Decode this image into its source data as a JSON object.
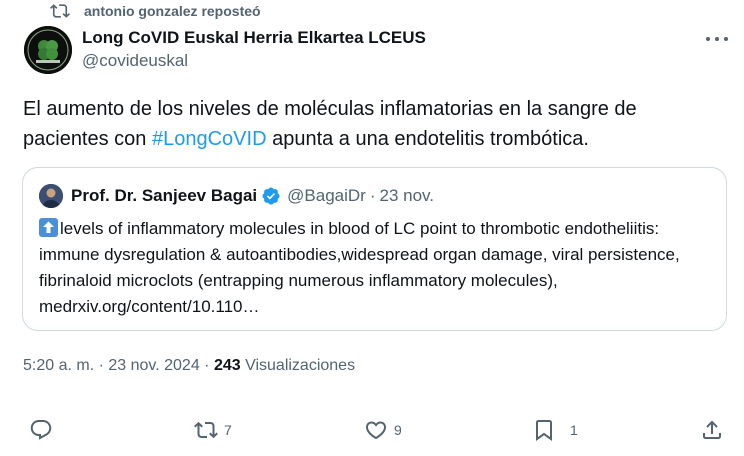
{
  "repost": {
    "icon": "repost-icon",
    "text": "antonio gonzalez reposteó"
  },
  "author": {
    "name": "Long CoVID Euskal Herria Elkartea LCEUS",
    "handle": "@covideuskal",
    "avatar_icon": "clover-logo"
  },
  "tweet": {
    "text_before": "El aumento de los niveles de moléculas inflamatorias en la sangre de pacientes con ",
    "hashtag": "#LongCoVID",
    "text_after": " apunta a una endotelitis trombótica."
  },
  "quote": {
    "name": "Prof. Dr. Sanjeev Bagai",
    "handle": "@BagaiDr",
    "separator": "·",
    "date": "23 nov.",
    "emoji": "up-arrow-emoji",
    "text": "levels of inflammatory molecules in blood of LC point to thrombotic endotheliitis: immune dysregulation & autoantibodies,widespread organ damage, viral persistence, fibrinaloid microclots (entrapping numerous inflammatory molecules), medrxiv.org/content/10.110…"
  },
  "meta": {
    "time": "5:20 a. m.",
    "sep1": " · ",
    "date": "23 nov. 2024",
    "sep2": " · ",
    "views": "243",
    "views_label": " Visualizaciones"
  },
  "actions": {
    "reply_count": "",
    "repost_count": "7",
    "like_count": "9",
    "bookmark_count": "1"
  },
  "colors": {
    "accent": "#1d9bf0",
    "muted": "#536471",
    "text": "#0f1419",
    "border": "#cfd9de"
  }
}
